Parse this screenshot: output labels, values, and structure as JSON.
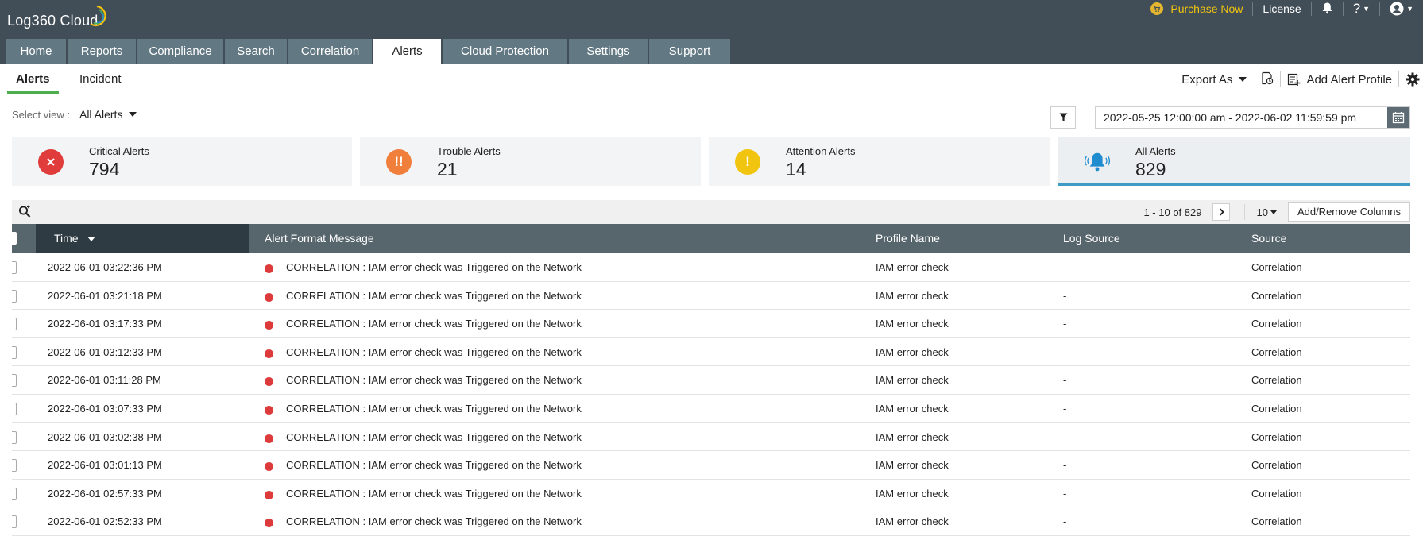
{
  "app": {
    "title": "Log360 Cloud"
  },
  "topbar": {
    "purchase_label": "Purchase Now",
    "license_label": "License",
    "help_label": "?"
  },
  "nav": {
    "tabs": [
      {
        "label": "Home"
      },
      {
        "label": "Reports"
      },
      {
        "label": "Compliance"
      },
      {
        "label": "Search"
      },
      {
        "label": "Correlation"
      },
      {
        "label": "Alerts",
        "active": true
      },
      {
        "label": "Cloud Protection"
      },
      {
        "label": "Settings"
      },
      {
        "label": "Support"
      }
    ]
  },
  "subnav": {
    "tabs": [
      {
        "label": "Alerts",
        "active": true
      },
      {
        "label": "Incident"
      }
    ],
    "export_label": "Export As",
    "add_profile_label": "Add Alert Profile"
  },
  "view": {
    "select_label": "Select view :",
    "selected": "All Alerts",
    "date_range": "2022-05-25 12:00:00 am - 2022-06-02 11:59:59 pm"
  },
  "summary": [
    {
      "label": "Critical Alerts",
      "count": "794",
      "icon": "close-icon",
      "color": "#e03c3c"
    },
    {
      "label": "Trouble Alerts",
      "count": "21",
      "icon": "double-exclamation-icon",
      "color": "#f07f3c"
    },
    {
      "label": "Attention Alerts",
      "count": "14",
      "icon": "exclamation-icon",
      "color": "#f1c40f"
    },
    {
      "label": "All Alerts",
      "count": "829",
      "icon": "bell-icon",
      "color": "#1f8ccf",
      "selected": true
    }
  ],
  "table": {
    "pagination": "1 - 10 of 829",
    "page_size": "10",
    "add_columns_label": "Add/Remove Columns",
    "columns": [
      "Time",
      "Alert Format Message",
      "Profile Name",
      "Log Source",
      "Source"
    ],
    "rows": [
      {
        "time": "2022-06-01 03:22:36 PM",
        "message": "CORRELATION : IAM error check was Triggered on the Network",
        "profile": "IAM error check",
        "log_source": "-",
        "source": "Correlation"
      },
      {
        "time": "2022-06-01 03:21:18 PM",
        "message": "CORRELATION : IAM error check was Triggered on the Network",
        "profile": "IAM error check",
        "log_source": "-",
        "source": "Correlation"
      },
      {
        "time": "2022-06-01 03:17:33 PM",
        "message": "CORRELATION : IAM error check was Triggered on the Network",
        "profile": "IAM error check",
        "log_source": "-",
        "source": "Correlation"
      },
      {
        "time": "2022-06-01 03:12:33 PM",
        "message": "CORRELATION : IAM error check was Triggered on the Network",
        "profile": "IAM error check",
        "log_source": "-",
        "source": "Correlation"
      },
      {
        "time": "2022-06-01 03:11:28 PM",
        "message": "CORRELATION : IAM error check was Triggered on the Network",
        "profile": "IAM error check",
        "log_source": "-",
        "source": "Correlation"
      },
      {
        "time": "2022-06-01 03:07:33 PM",
        "message": "CORRELATION : IAM error check was Triggered on the Network",
        "profile": "IAM error check",
        "log_source": "-",
        "source": "Correlation"
      },
      {
        "time": "2022-06-01 03:02:38 PM",
        "message": "CORRELATION : IAM error check was Triggered on the Network",
        "profile": "IAM error check",
        "log_source": "-",
        "source": "Correlation"
      },
      {
        "time": "2022-06-01 03:01:13 PM",
        "message": "CORRELATION : IAM error check was Triggered on the Network",
        "profile": "IAM error check",
        "log_source": "-",
        "source": "Correlation"
      },
      {
        "time": "2022-06-01 02:57:33 PM",
        "message": "CORRELATION : IAM error check was Triggered on the Network",
        "profile": "IAM error check",
        "log_source": "-",
        "source": "Correlation"
      },
      {
        "time": "2022-06-01 02:52:33 PM",
        "message": "CORRELATION : IAM error check was Triggered on the Network",
        "profile": "IAM error check",
        "log_source": "-",
        "source": "Correlation"
      }
    ]
  }
}
